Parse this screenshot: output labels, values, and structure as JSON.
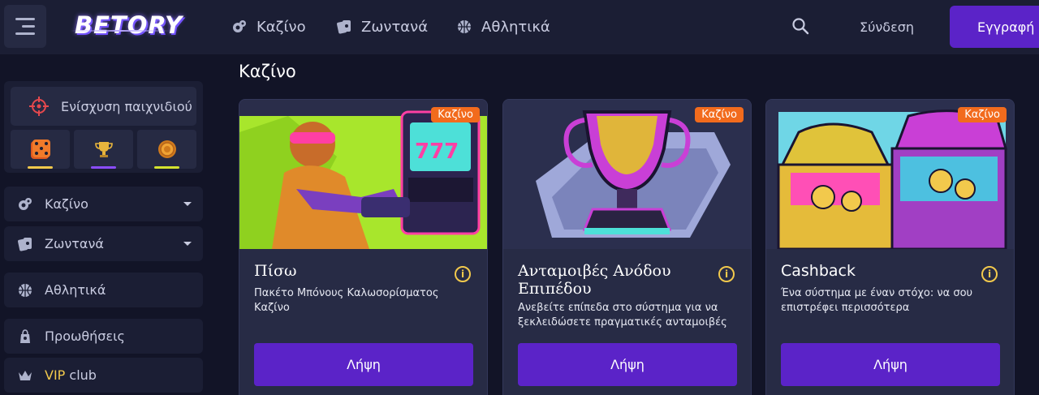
{
  "header": {
    "logo": "BETORY",
    "nav": [
      {
        "label": "Καζίνο",
        "icon": "casino-chips-icon"
      },
      {
        "label": "Ζωντανά",
        "icon": "playing-cards-icon"
      },
      {
        "label": "Αθλητικά",
        "icon": "basketball-icon"
      }
    ],
    "login_label": "Σύνδεση",
    "signup_label": "Εγγραφή"
  },
  "sidebar": {
    "boost_label": "Ενίσχυση παιχνιδιού",
    "game_tiles": [
      {
        "icon": "dice-icon",
        "bar_color": "#f2c94c"
      },
      {
        "icon": "trophy-icon",
        "bar_color": "#8b4dff"
      },
      {
        "icon": "coin-icon",
        "bar_color": "#d4e32f"
      }
    ],
    "items": [
      {
        "label": "Καζίνο",
        "icon": "casino-chips-icon",
        "dropdown": true
      },
      {
        "label": "Ζωντανά",
        "icon": "playing-cards-icon",
        "dropdown": true
      },
      {
        "label": "Αθλητικά",
        "icon": "basketball-icon",
        "dropdown": false
      },
      {
        "label": "Προωθήσεις",
        "icon": "gift-bag-icon",
        "dropdown": false
      }
    ],
    "vip": {
      "highlight": "VIP",
      "rest": " club"
    }
  },
  "main": {
    "section_title": "Καζίνο",
    "cards": [
      {
        "badge": "Καζίνο",
        "title": "Πίσω",
        "description": "Πακέτο Μπόνους Καλωσορίσματος Καζίνο",
        "button": "Λήψη"
      },
      {
        "badge": "Καζίνο",
        "title": "Ανταμοιβές Ανόδου Επιπέδου",
        "description": "Ανεβείτε επίπεδα στο σύστημα για να ξεκλειδώσετε πραγματικές ανταμοιβές",
        "button": "Λήψη"
      },
      {
        "badge": "Καζίνο",
        "title": "Cashback",
        "description": "Ένα σύστημα με έναν στόχο: να σου επιστρέφει περισσότερα",
        "button": "Λήψη"
      }
    ]
  },
  "colors": {
    "accent": "#5b23c8",
    "badge": "#f26b1d",
    "vip": "#f2c94c"
  }
}
